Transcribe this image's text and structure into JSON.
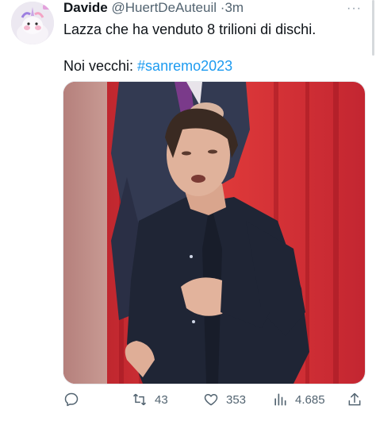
{
  "tweet": {
    "author_name": "Davide",
    "author_handle": "@HuertDeAuteuil",
    "separator": "·",
    "time": "3m",
    "text_line1": "Lazza che ha venduto 8 trilioni di dischi.",
    "text_line2_prefix": "Noi vecchi: ",
    "hashtag": "#sanremo2023",
    "more_label": "···"
  },
  "actions": {
    "reply_count": "",
    "retweet_count": "43",
    "like_count": "353",
    "views_count": "4.685"
  },
  "colors": {
    "accent": "#1d9bf0",
    "muted": "#536471",
    "curtain_red": "#d42b2b"
  },
  "icons": [
    "avatar-unicorn",
    "reply-icon",
    "retweet-icon",
    "like-icon",
    "views-icon",
    "share-icon",
    "more-icon"
  ]
}
